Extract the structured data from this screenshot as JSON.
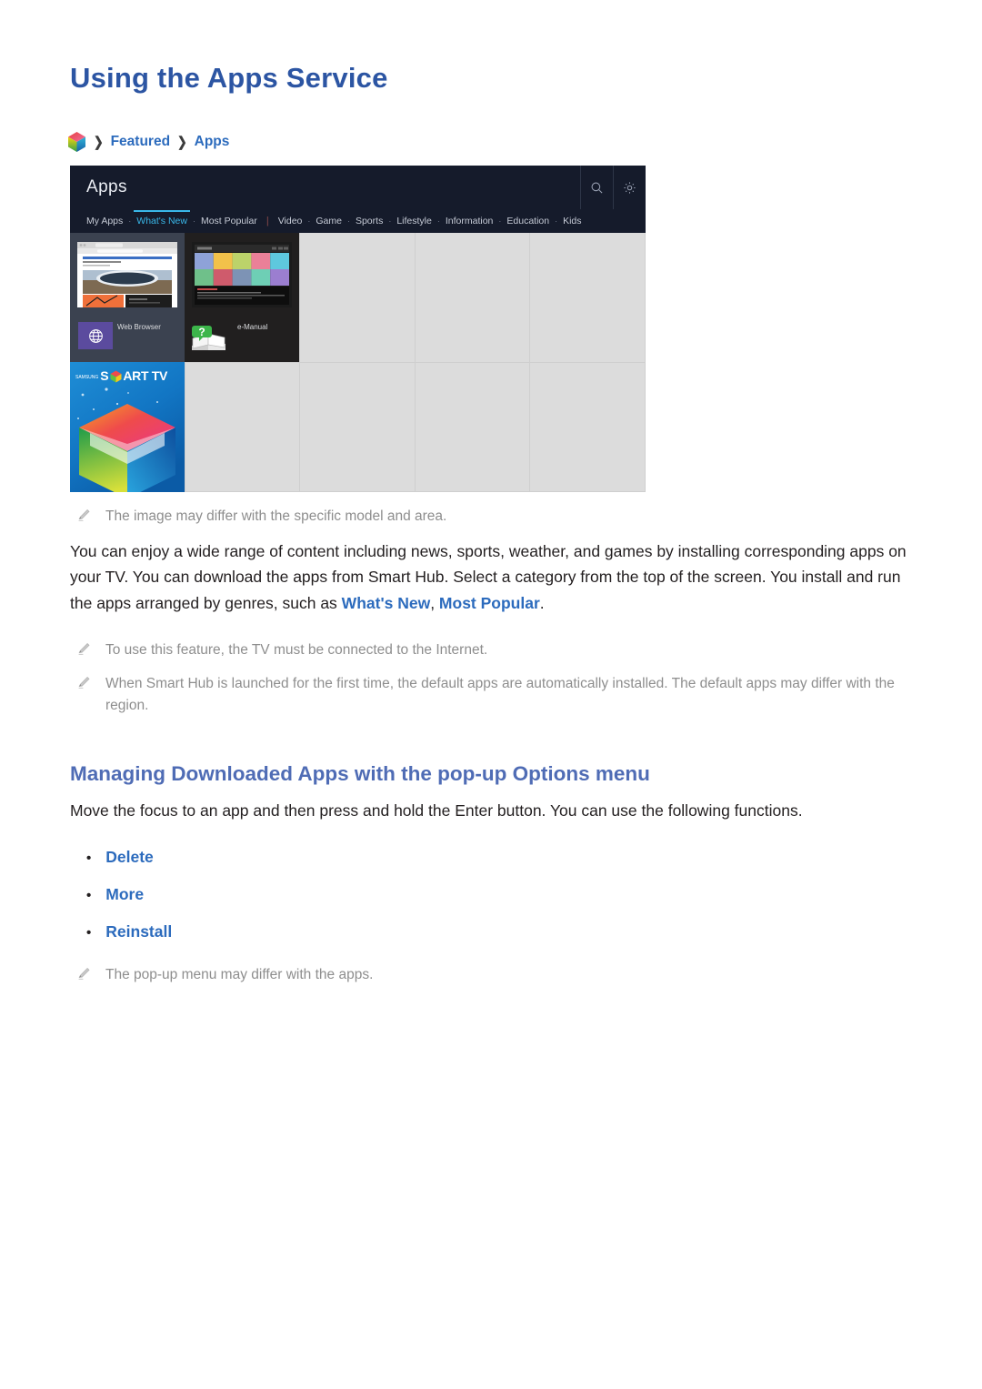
{
  "document": {
    "title": "Using the Apps Service",
    "breadcrumb": {
      "hub_icon": "smart-hub-cube-icon",
      "separator": "❯",
      "items": [
        "Featured",
        "Apps"
      ]
    }
  },
  "tv_screenshot": {
    "header": {
      "title": "Apps",
      "search_icon": "search-icon",
      "settings_icon": "gear-icon"
    },
    "nav": {
      "items": [
        {
          "label": "My Apps",
          "active": false
        },
        {
          "label": "What's New",
          "active": true
        },
        {
          "label": "Most Popular",
          "active": false
        },
        {
          "label": "Video",
          "active": false
        },
        {
          "label": "Game",
          "active": false
        },
        {
          "label": "Sports",
          "active": false
        },
        {
          "label": "Lifestyle",
          "active": false
        },
        {
          "label": "Information",
          "active": false
        },
        {
          "label": "Education",
          "active": false
        },
        {
          "label": "Kids",
          "active": false
        }
      ],
      "separator_after": "Most Popular",
      "dot": "·",
      "pipe": "|"
    },
    "tiles": [
      {
        "label": "Web Browser",
        "icon": "globe-icon"
      },
      {
        "label": "e-Manual",
        "icon": "open-book-icon"
      }
    ],
    "banner": {
      "brand": "SAMSUNG",
      "text_left": "S",
      "text_right": "ART TV",
      "cube_icon": "smart-tv-cube-icon"
    }
  },
  "notes": {
    "image_note": "The image may differ with the specific model and area.",
    "internet_note": "To use this feature, the TV must be connected to the Internet.",
    "default_apps_note": "When Smart Hub is launched for the first time, the default apps are automatically installed. The default apps may differ with the region.",
    "popup_note": "The pop-up menu may differ with the apps.",
    "icon": "pencil-note-icon"
  },
  "body": {
    "paragraph_1": {
      "part_1": "You can enjoy a wide range of content including news, sports, weather, and games by installing corresponding apps on your TV. You can download the apps from Smart Hub. Select a category from the top of the screen. You install and run the apps arranged by genres, such as ",
      "highlight_1": "What's New",
      "part_2": ", ",
      "highlight_2": "Most Popular",
      "part_3": "."
    }
  },
  "section": {
    "heading": "Managing Downloaded Apps with the pop-up Options menu",
    "intro": "Move the focus to an app and then press and hold the Enter button. You can use the following functions.",
    "options": [
      {
        "label": "Delete"
      },
      {
        "label": "More"
      },
      {
        "label": "Reinstall"
      }
    ],
    "bullet_glyph": "•"
  },
  "colors": {
    "title_blue": "#2c55a3",
    "link_blue": "#2c6bbd",
    "section_blue": "#4f6cb5",
    "note_gray": "#8e8e8e",
    "tv_header_dark": "#151b2b",
    "tv_accent_cyan": "#39b7e8",
    "tv_grid_bg": "#dcdcdc"
  }
}
